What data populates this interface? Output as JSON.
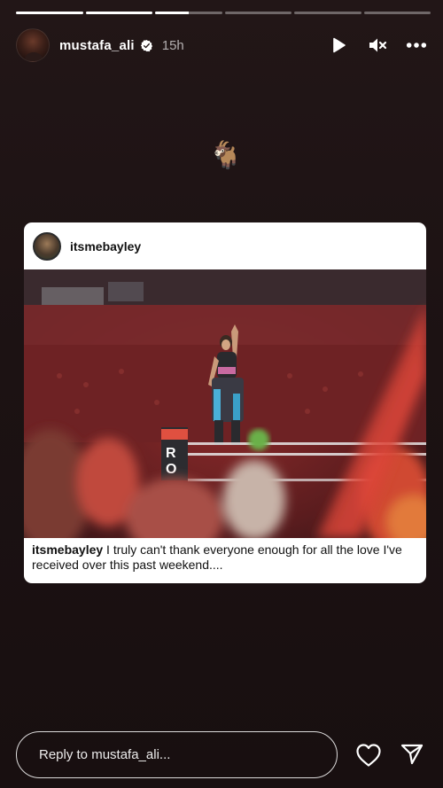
{
  "story": {
    "progress": [
      1,
      1,
      0.5,
      0,
      0,
      0
    ],
    "header": {
      "username": "mustafa_ali",
      "verified": true,
      "time": "15h",
      "icons": [
        "play-icon",
        "mute-icon",
        "more-icon"
      ]
    },
    "sticker": {
      "emoji": "🐐"
    },
    "post": {
      "username": "itsmebayley",
      "caption_user": "itsmebayley",
      "caption_text": " I truly can't thank everyone enough for all the love I've received over this past weekend...."
    },
    "reply": {
      "placeholder": "Reply to mustafa_ali..."
    },
    "colors": {
      "background": "#1c1213",
      "card": "#ffffff",
      "verified": "#ffffff"
    }
  }
}
